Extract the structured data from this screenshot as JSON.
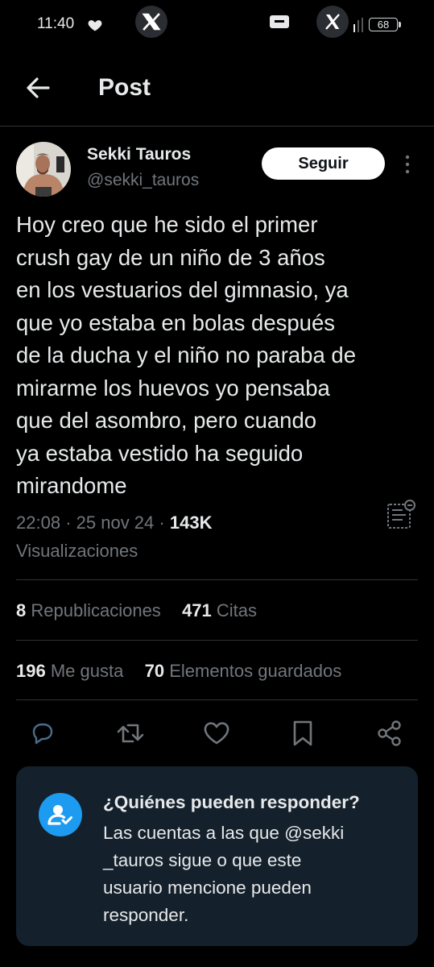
{
  "status_bar": {
    "time": "11:40",
    "battery": "68"
  },
  "header": {
    "title": "Post"
  },
  "author": {
    "name": "Sekki Tauros",
    "handle": "@sekki_tauros",
    "follow_label": "Seguir"
  },
  "tweet": {
    "text": "Hoy creo que he sido el primer\ncrush gay de un niño de 3 años\nen los vestuarios del gimnasio, ya\nque yo estaba en bolas después\nde la ducha y el niño no paraba de\nmirarme los huevos yo pensaba\nque del asombro, pero cuando\nya estaba vestido ha seguido\nmirandome",
    "time": "22:08",
    "date": "25 nov 24",
    "views": "143K",
    "views_label": "Visualizaciones"
  },
  "stats": {
    "reposts": "8",
    "reposts_label": "Republicaciones",
    "quotes": "471",
    "quotes_label": "Citas",
    "likes": "196",
    "likes_label": "Me gusta",
    "bookmarks": "70",
    "bookmarks_label": "Elementos guardados"
  },
  "reply_info": {
    "title": "¿Quiénes pueden responder?",
    "body": "Las cuentas a las que @sekki\n_tauros sigue o que este\nusuario mencione pueden\nresponder."
  },
  "colors": {
    "background": "#000000",
    "text": "#e7e9ea",
    "muted": "#71767b",
    "card": "#14202b",
    "accent": "#1d9bf0"
  },
  "icons": [
    "heart-icon",
    "x-logo-icon",
    "notification-icon",
    "signal-icon",
    "battery-icon",
    "back-arrow-icon",
    "more-vertical-icon",
    "post-analytics-icon",
    "reply-icon",
    "repost-icon",
    "like-icon",
    "bookmark-icon",
    "share-icon",
    "user-check-icon"
  ]
}
